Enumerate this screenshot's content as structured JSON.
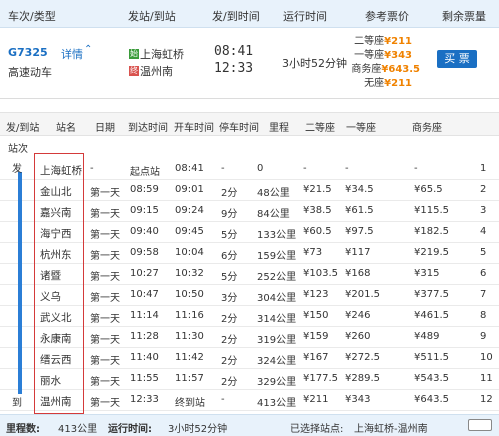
{
  "header": {
    "col_train": "车次/类型",
    "col_station": "发站/到站",
    "col_time": "发/到时间",
    "col_duration": "运行时间",
    "col_price": "参考票价",
    "col_remain": "剩余票量"
  },
  "train": {
    "number": "G7325",
    "detail_link": "详情",
    "chevron": "chevron-up-icon",
    "type": "高速动车",
    "start_badge": "始",
    "end_badge": "终",
    "from_station": "上海虹桥",
    "to_station": "温州南",
    "depart_time": "08:41",
    "arrive_time": "12:33",
    "duration": "3小时52分钟",
    "prices": [
      {
        "label": "二等座",
        "value": "¥211"
      },
      {
        "label": "一等座",
        "value": "¥343"
      },
      {
        "label": "商务座",
        "value": "¥643.5"
      },
      {
        "label": "无座",
        "value": "¥211"
      }
    ],
    "buy_label": "买 票"
  },
  "stops_header": {
    "col_side": "发/到站",
    "col_name": "站名",
    "col_day": "日期",
    "col_arrive": "到达时间",
    "col_depart": "开车时间",
    "col_stay": "停车时间",
    "col_distance": "里程",
    "col_second": "二等座",
    "col_first": "一等座",
    "col_business": "商务座",
    "sub_label": "站次"
  },
  "rail": {
    "top_label": "发",
    "bottom_label": "到"
  },
  "stops": [
    {
      "name": "上海虹桥",
      "day": "-",
      "arrive": "起点站",
      "depart": "08:41",
      "stay": "-",
      "distance": "0",
      "second": "-",
      "first": "-",
      "business": "-",
      "index": "1"
    },
    {
      "name": "金山北",
      "day": "第一天",
      "arrive": "08:59",
      "depart": "09:01",
      "stay": "2分",
      "distance": "48公里",
      "second": "¥21.5",
      "first": "¥34.5",
      "business": "¥65.5",
      "index": "2"
    },
    {
      "name": "嘉兴南",
      "day": "第一天",
      "arrive": "09:15",
      "depart": "09:24",
      "stay": "9分",
      "distance": "84公里",
      "second": "¥38.5",
      "first": "¥61.5",
      "business": "¥115.5",
      "index": "3"
    },
    {
      "name": "海宁西",
      "day": "第一天",
      "arrive": "09:40",
      "depart": "09:45",
      "stay": "5分",
      "distance": "133公里",
      "second": "¥60.5",
      "first": "¥97.5",
      "business": "¥182.5",
      "index": "4"
    },
    {
      "name": "杭州东",
      "day": "第一天",
      "arrive": "09:58",
      "depart": "10:04",
      "stay": "6分",
      "distance": "159公里",
      "second": "¥73",
      "first": "¥117",
      "business": "¥219.5",
      "index": "5"
    },
    {
      "name": "诸暨",
      "day": "第一天",
      "arrive": "10:27",
      "depart": "10:32",
      "stay": "5分",
      "distance": "252公里",
      "second": "¥103.5",
      "first": "¥168",
      "business": "¥315",
      "index": "6"
    },
    {
      "name": "义乌",
      "day": "第一天",
      "arrive": "10:47",
      "depart": "10:50",
      "stay": "3分",
      "distance": "304公里",
      "second": "¥123",
      "first": "¥201.5",
      "business": "¥377.5",
      "index": "7"
    },
    {
      "name": "武义北",
      "day": "第一天",
      "arrive": "11:14",
      "depart": "11:16",
      "stay": "2分",
      "distance": "314公里",
      "second": "¥150",
      "first": "¥246",
      "business": "¥461.5",
      "index": "8"
    },
    {
      "name": "永康南",
      "day": "第一天",
      "arrive": "11:28",
      "depart": "11:30",
      "stay": "2分",
      "distance": "319公里",
      "second": "¥159",
      "first": "¥260",
      "business": "¥489",
      "index": "9"
    },
    {
      "name": "缙云西",
      "day": "第一天",
      "arrive": "11:40",
      "depart": "11:42",
      "stay": "2分",
      "distance": "324公里",
      "second": "¥167",
      "first": "¥272.5",
      "business": "¥511.5",
      "index": "10"
    },
    {
      "name": "丽水",
      "day": "第一天",
      "arrive": "11:55",
      "depart": "11:57",
      "stay": "2分",
      "distance": "329公里",
      "second": "¥177.5",
      "first": "¥289.5",
      "business": "¥543.5",
      "index": "11"
    },
    {
      "name": "温州南",
      "day": "第一天",
      "arrive": "12:33",
      "depart": "终到站",
      "stay": "-",
      "distance": "413公里",
      "second": "¥211",
      "first": "¥343",
      "business": "¥643.5",
      "index": "12"
    }
  ],
  "footer": {
    "distance_label": "里程数:",
    "distance_value": "413公里",
    "duration_label": "运行时间:",
    "duration_value": "3小时52分钟",
    "selected_label": "已选择站点:",
    "selected_value": "上海虹桥-温州南"
  }
}
